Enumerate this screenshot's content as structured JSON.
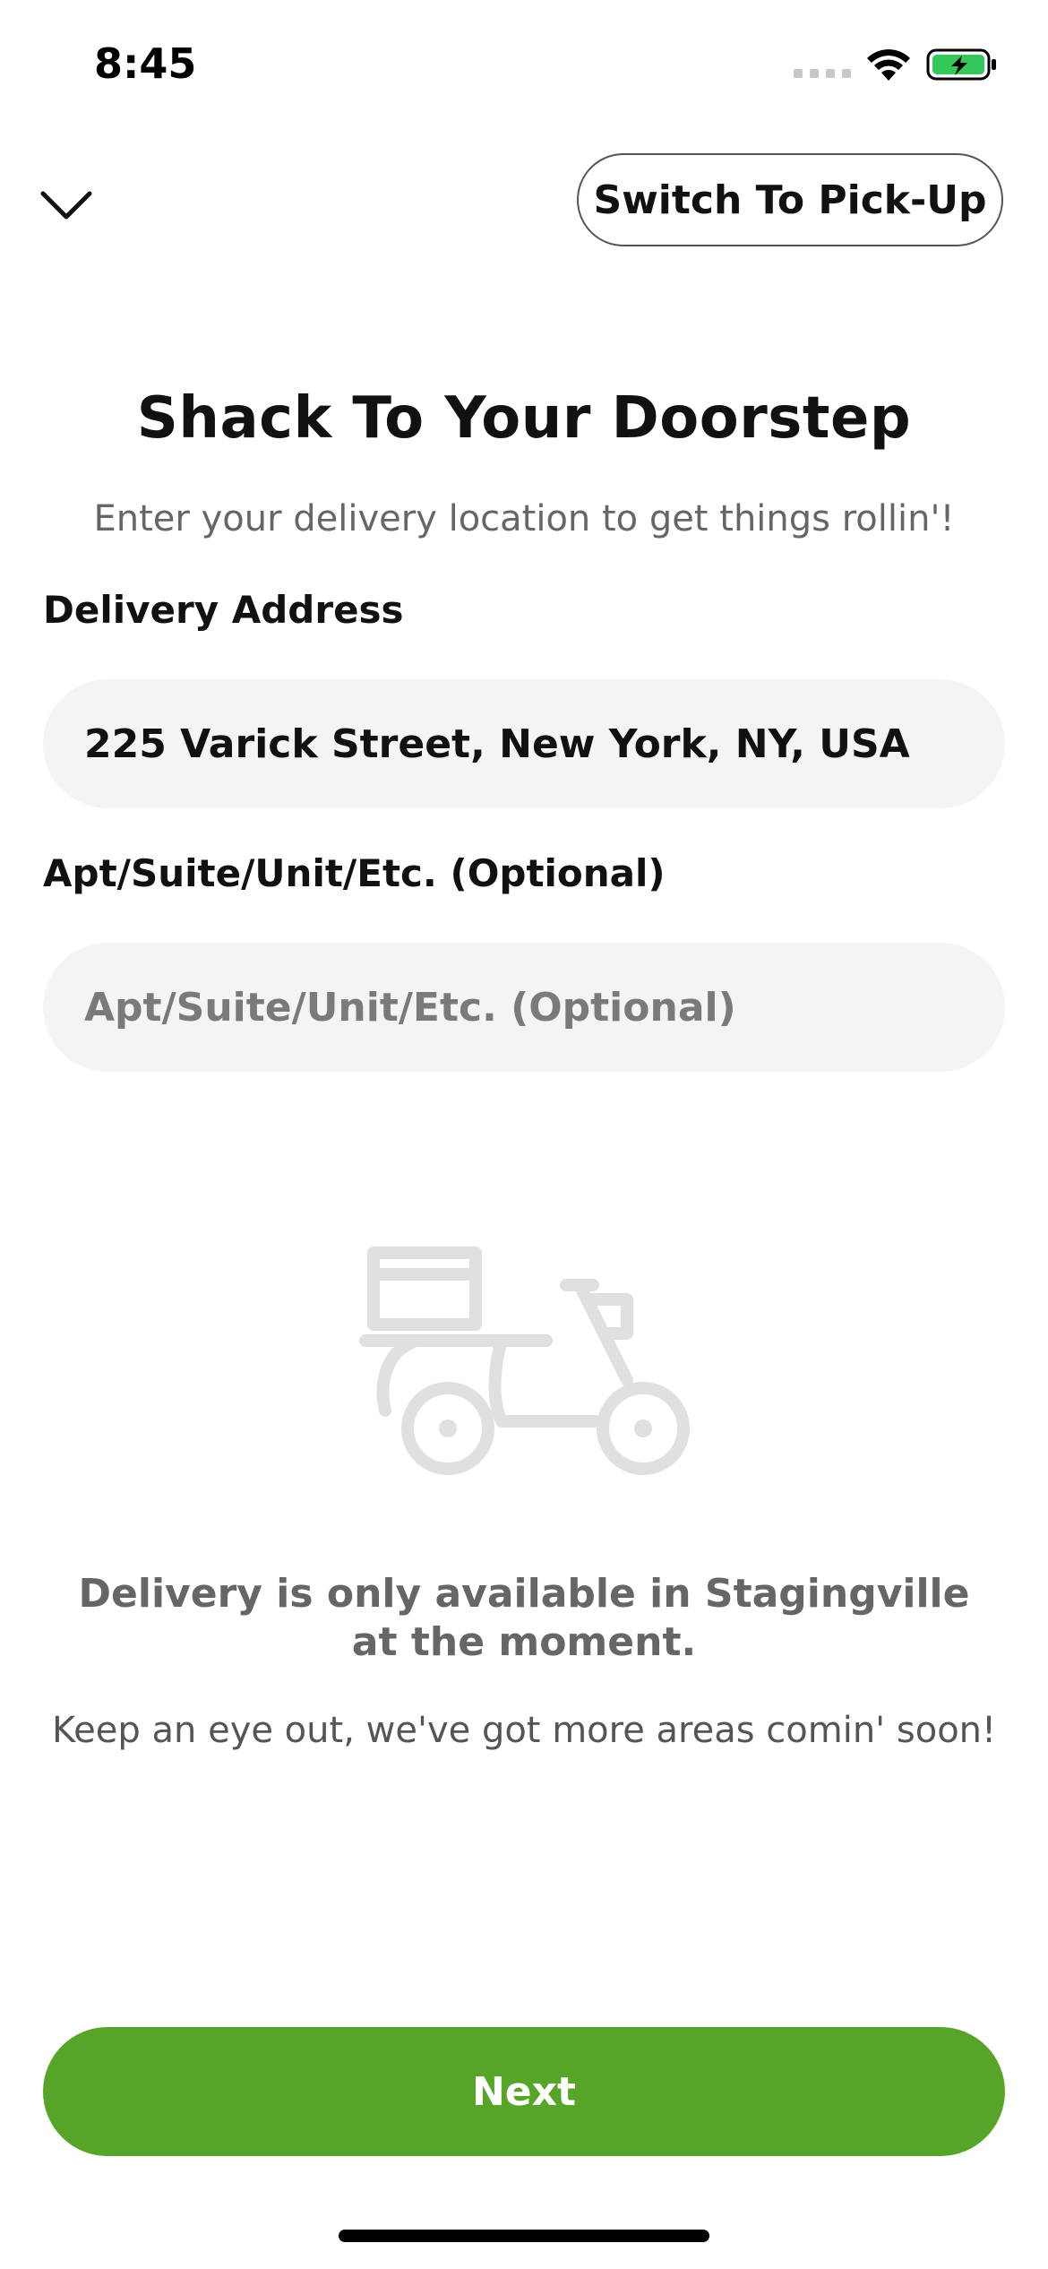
{
  "status_bar": {
    "time": "8:45",
    "icons": [
      "signal-icon",
      "wifi-icon",
      "battery-charging-icon"
    ],
    "battery_color": "#34c759"
  },
  "header": {
    "collapse_icon": "chevron-down-icon",
    "switch_label": "Switch To Pick-Up"
  },
  "main": {
    "title": "Shack To Your Doorstep",
    "subtitle": "Enter your delivery location to get things rollin'!",
    "address": {
      "label": "Delivery Address",
      "value": "225 Varick Street, New York, NY, USA"
    },
    "apt": {
      "label": "Apt/Suite/Unit/Etc. (Optional)",
      "value": "",
      "placeholder": "Apt/Suite/Unit/Etc. (Optional)"
    },
    "illustration_icon": "delivery-scooter-icon",
    "notice": "Delivery is only available in Stagingville at the moment.",
    "notice_sub": "Keep an eye out, we've got more areas comin' soon!"
  },
  "footer": {
    "next_label": "Next",
    "accent_color": "#56a528"
  }
}
